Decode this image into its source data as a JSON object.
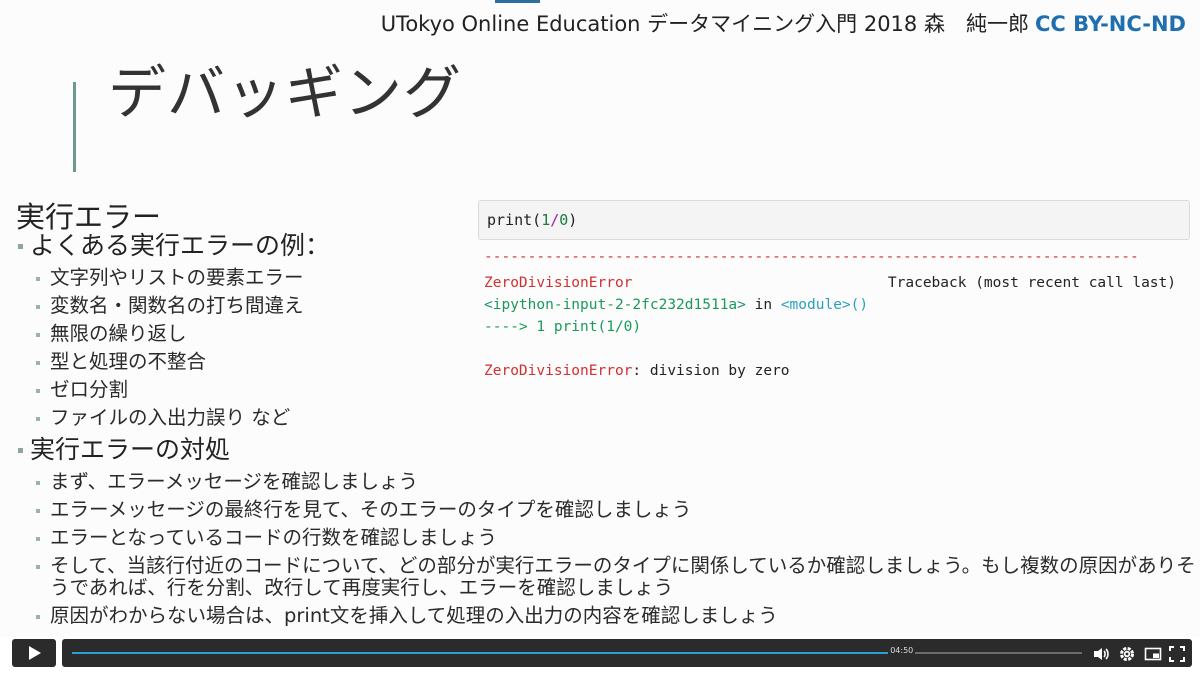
{
  "header": {
    "course": "UTokyo Online Education データマイニング入門 2018 森　純一郎",
    "license": "CC BY-NC-ND"
  },
  "slide": {
    "title": "デバッギング",
    "section_heading": "実行エラー",
    "group1": {
      "heading": "よくある実行エラーの例：",
      "items": [
        "文字列やリストの要素エラー",
        "変数名・関数名の打ち間違え",
        "無限の繰り返し",
        "型と処理の不整合",
        "ゼロ分割",
        "ファイルの入出力誤り など"
      ]
    },
    "group2": {
      "heading": "実行エラーの対処",
      "items": [
        "まず、エラーメッセージを確認しましょう",
        "エラーメッセージの最終行を見て、そのエラーのタイプを確認しましょう",
        "エラーとなっているコードの行数を確認しましょう",
        "そして、当該行付近のコードについて、どの部分が実行エラーのタイプに関係しているか確認しましょう。もし複数の原因がありそうであれば、行を分割、改行して再度実行し、エラーを確認しましょう",
        "原因がわからない場合は、print文を挿入して処理の入出力の内容を確認しましょう"
      ]
    },
    "code": {
      "fn": "print(",
      "num1": "1",
      "op": "/",
      "num2": "0",
      "close": ")"
    },
    "output": {
      "dashes": "---------------------------------------------------------------------------",
      "error_name": "ZeroDivisionError",
      "traceback": "Traceback (most recent call last)",
      "input_ref": "<ipython-input-2-2fc232d1511a>",
      "in_word": " in ",
      "module_ref": "<module>",
      "module_paren": "()",
      "arrow_line": "----> 1 print(1/0)",
      "final_error": "ZeroDivisionError",
      "final_msg": ": division by zero"
    }
  },
  "player": {
    "time_tooltip": "04:50",
    "progress": 0.82,
    "icons": [
      "play-icon",
      "volume-icon",
      "settings-icon",
      "pip-icon",
      "fullscreen-icon"
    ]
  }
}
